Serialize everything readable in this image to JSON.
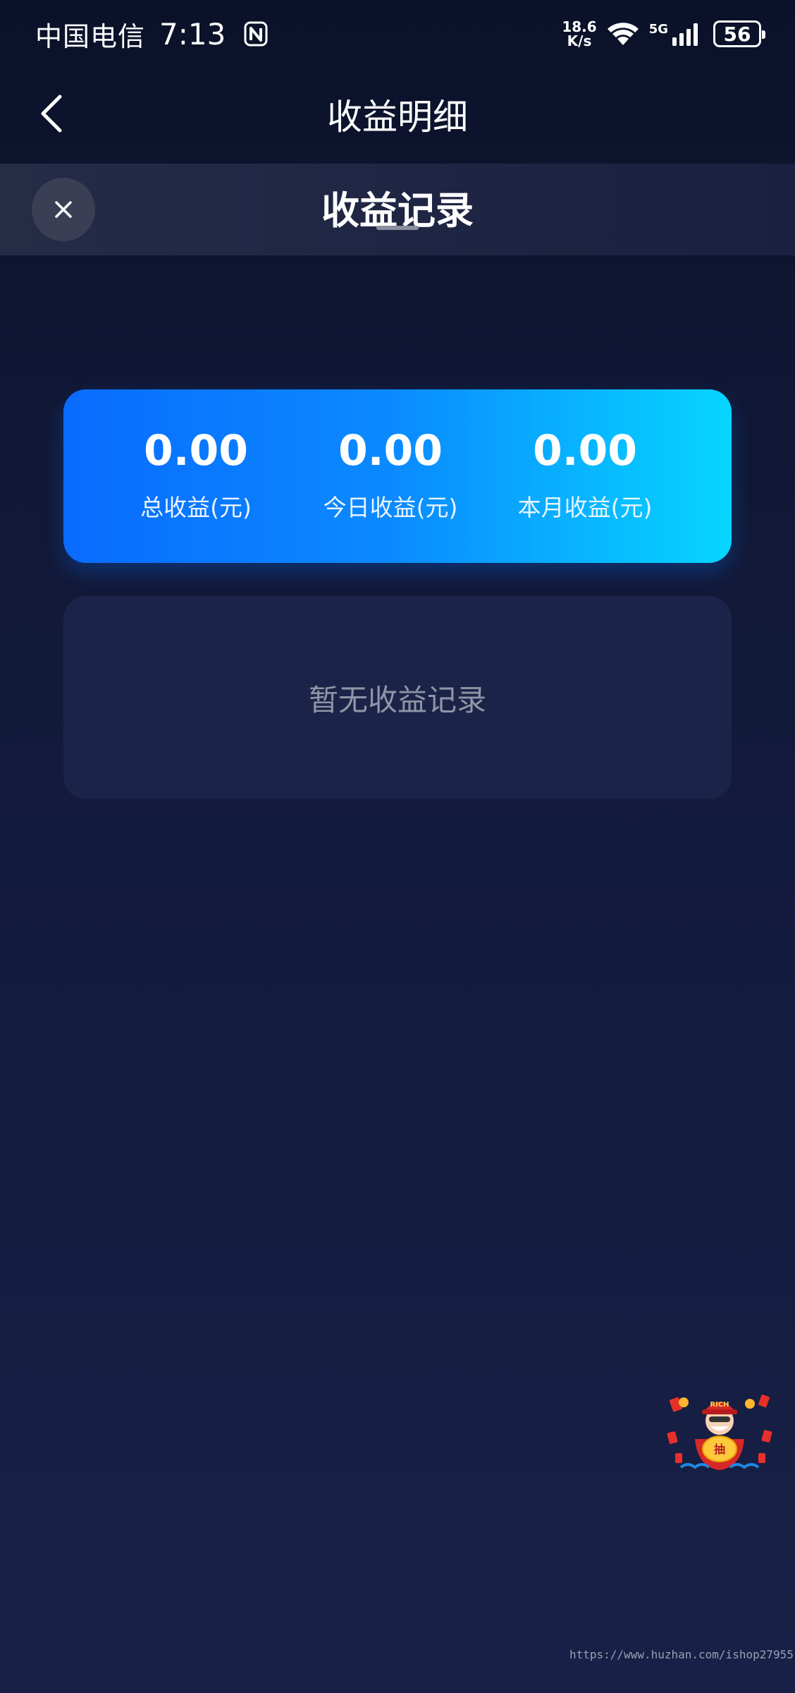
{
  "status_bar": {
    "carrier": "中国电信",
    "time": "7:13",
    "net_speed_value": "18.6",
    "net_speed_unit": "K/s",
    "network_type": "5G",
    "battery_level": "56"
  },
  "header": {
    "title": "收益明细"
  },
  "sheet": {
    "title": "收益记录"
  },
  "summary": {
    "stats": [
      {
        "value": "0.00",
        "label": "总收益(元)"
      },
      {
        "value": "0.00",
        "label": "今日收益(元)"
      },
      {
        "value": "0.00",
        "label": "本月收益(元)"
      }
    ]
  },
  "records": {
    "empty_message": "暂无收益记录"
  },
  "floating_widget": {
    "cap_text": "RICH",
    "bag_text": "抽"
  },
  "watermark": {
    "text": "https://www.huzhan.com/ishop27955"
  },
  "icons": {
    "back": "chevron-left-icon",
    "close": "close-icon",
    "nfc": "nfc-icon",
    "wifi": "wifi-icon",
    "signal": "signal-icon"
  },
  "colors": {
    "background": "#111836",
    "card_gradient_start": "#0a6bff",
    "card_gradient_end": "#06d6ff",
    "empty_card": "#1b2448",
    "empty_text": "#8f95a6"
  }
}
